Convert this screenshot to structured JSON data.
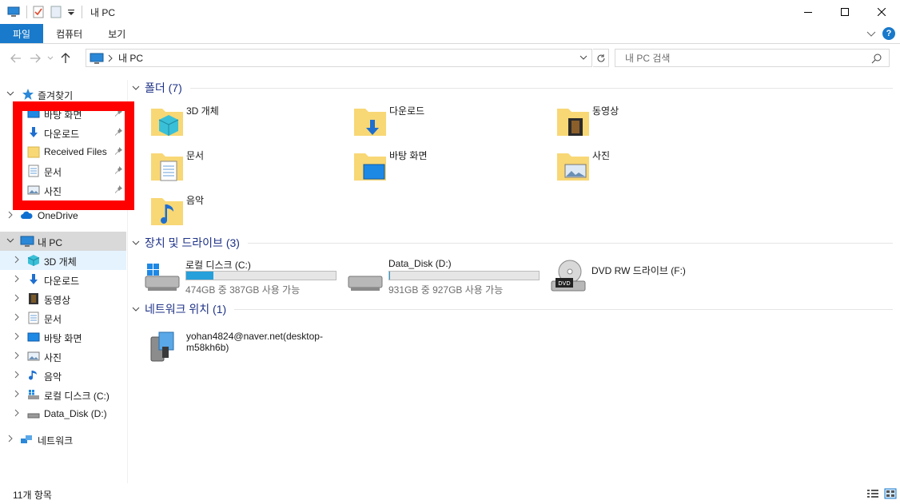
{
  "titlebar": {
    "title": "내 PC"
  },
  "ribbon": {
    "tabs": [
      {
        "label": "파일"
      },
      {
        "label": "컴퓨터"
      },
      {
        "label": "보기"
      }
    ]
  },
  "address": {
    "location": "내 PC"
  },
  "search": {
    "placeholder": "내 PC 검색"
  },
  "sidebar": {
    "quick_access": {
      "label": "즐겨찾기",
      "items": [
        {
          "label": "바탕 화면"
        },
        {
          "label": "다운로드"
        },
        {
          "label": "Received Files"
        },
        {
          "label": "문서"
        },
        {
          "label": "사진"
        }
      ]
    },
    "onedrive": {
      "label": "OneDrive"
    },
    "thispc": {
      "label": "내 PC",
      "items": [
        {
          "label": "3D 개체"
        },
        {
          "label": "다운로드"
        },
        {
          "label": "동영상"
        },
        {
          "label": "문서"
        },
        {
          "label": "바탕 화면"
        },
        {
          "label": "사진"
        },
        {
          "label": "음악"
        },
        {
          "label": "로컬 디스크 (C:)"
        },
        {
          "label": "Data_Disk (D:)"
        }
      ]
    },
    "network": {
      "label": "네트워크"
    }
  },
  "folders": {
    "header": "폴더 (7)",
    "items": [
      {
        "label": "3D 개체"
      },
      {
        "label": "다운로드"
      },
      {
        "label": "동영상"
      },
      {
        "label": "문서"
      },
      {
        "label": "바탕 화면"
      },
      {
        "label": "사진"
      },
      {
        "label": "음악"
      }
    ]
  },
  "devices": {
    "header": "장치 및 드라이브 (3)",
    "items": [
      {
        "label": "로컬 디스크 (C:)",
        "free": "474GB 중 387GB 사용 가능",
        "used_fraction": 0.18
      },
      {
        "label": "Data_Disk (D:)",
        "free": "931GB 중 927GB 사용 가능",
        "used_fraction": 0.004
      },
      {
        "label": "DVD RW 드라이브 (F:)"
      }
    ]
  },
  "network_locations": {
    "header": "네트워크 위치 (1)",
    "items": [
      {
        "label": "yohan4824@naver.net(desktop-m58kh6b)"
      }
    ]
  },
  "status": {
    "count": "11개 항목"
  },
  "colors": {
    "accent": "#1979ca",
    "highlight": "#ff0000",
    "bar_fill": "#26a0da",
    "folder": "#f8d775"
  }
}
